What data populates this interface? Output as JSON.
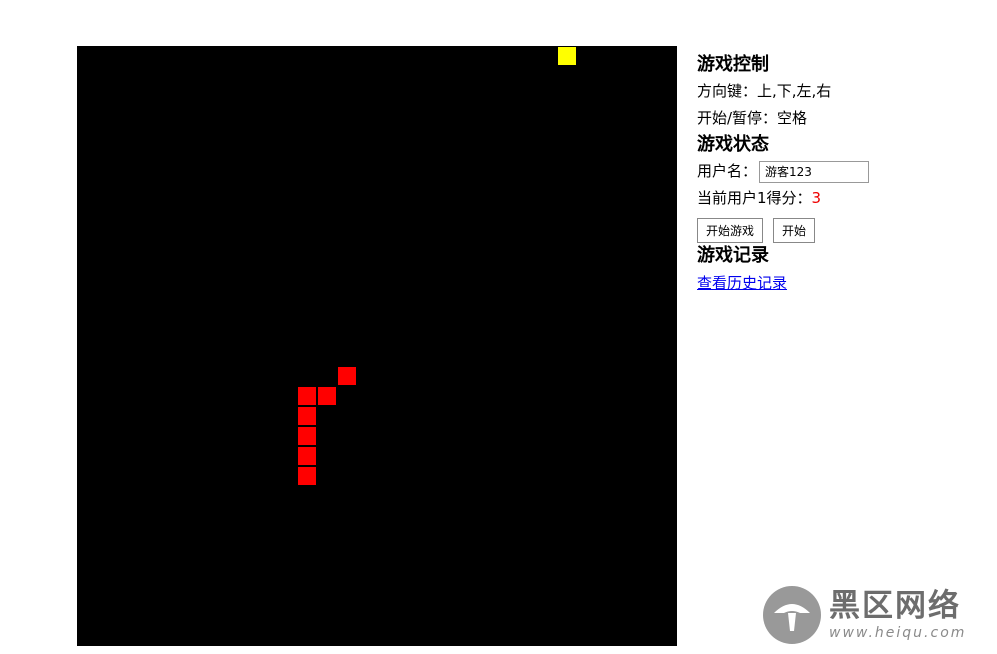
{
  "game": {
    "grid": {
      "cols": 30,
      "rows": 30
    },
    "colors": {
      "board": "#000000",
      "snake": "#ff0000",
      "food": "#ffff00"
    },
    "snake": [
      [
        13,
        16
      ],
      [
        12,
        17
      ],
      [
        11,
        17
      ],
      [
        11,
        18
      ],
      [
        11,
        19
      ],
      [
        11,
        20
      ],
      [
        11,
        21
      ]
    ],
    "food": [
      24,
      0
    ]
  },
  "controls": {
    "title": "游戏控制",
    "arrows": "方向键：上,下,左,右",
    "pause": "开始/暂停：空格"
  },
  "status": {
    "title": "游戏状态",
    "username_label": "用户名：",
    "username_value": "游客123",
    "score_label": "当前用户1得分：",
    "score_value": "3",
    "start_game_button": "开始游戏",
    "start_button": "开始"
  },
  "records": {
    "title": "游戏记录",
    "history_link": "查看历史记录"
  },
  "watermark": {
    "name": "黑区网络",
    "url": "www.heiqu.com"
  }
}
